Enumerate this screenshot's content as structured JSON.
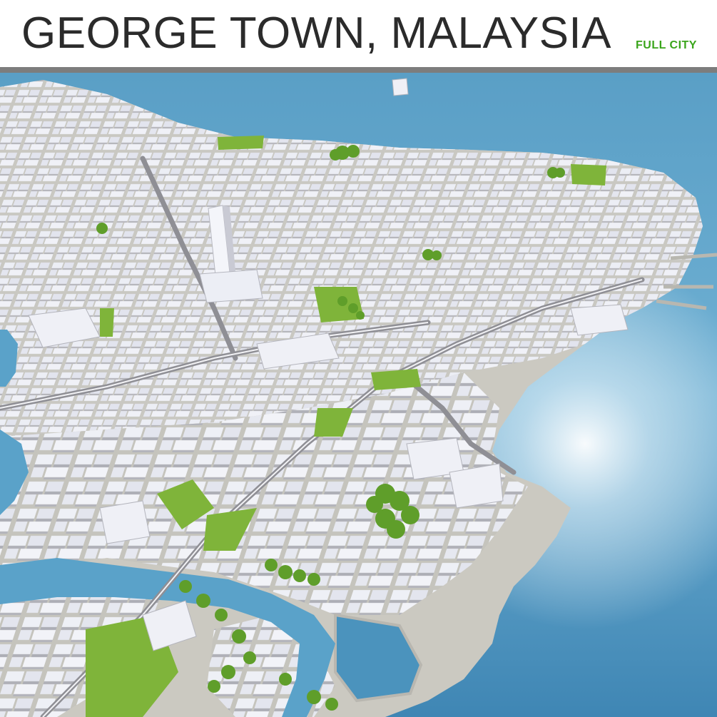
{
  "header": {
    "title": "GEORGE TOWN, MALAYSIA",
    "subtitle": "FULL CITY"
  },
  "colors": {
    "title_text": "#2b2b2b",
    "subtitle_text": "#3aa51b",
    "divider": "#7d7d7d",
    "sea": "#4f9bc4",
    "land": "#c8c6bf",
    "buildings": "#e7e8f0",
    "greenery": "#7fb43a"
  },
  "image": {
    "subject": "aerial 3D city model render",
    "icon": "city-3d-render"
  }
}
